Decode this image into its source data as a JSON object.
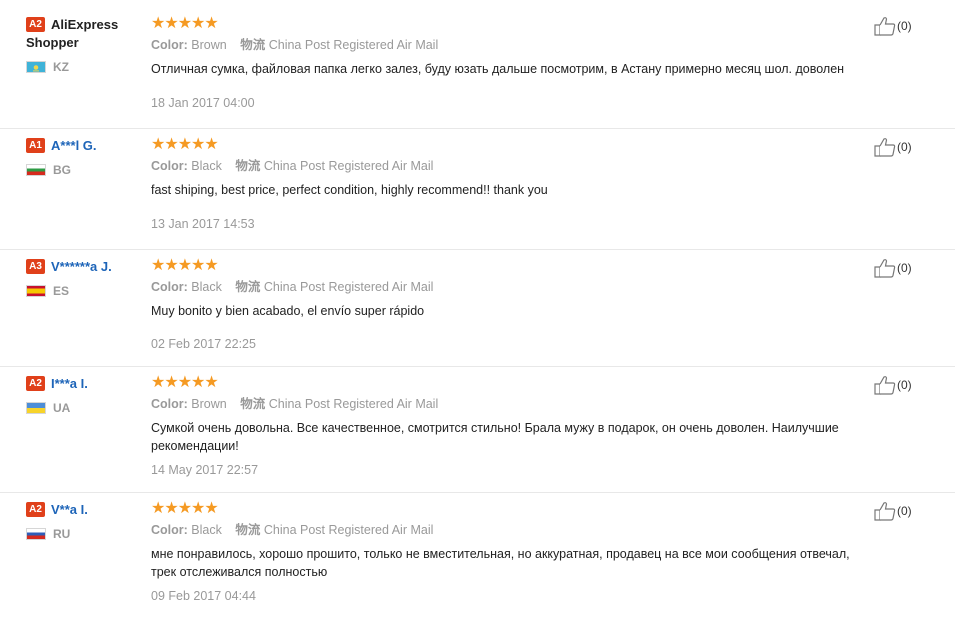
{
  "reviews": [
    {
      "level": "A2",
      "user": "AliExpress Shopper",
      "country": "KZ",
      "stars": "★★★★★",
      "color_label": "Color:",
      "color_value": "Brown",
      "shipping_label": "物流",
      "shipping_value": "China Post Registered Air Mail",
      "text": "Отличная сумка, файловая папка легко залез, буду юзать дальше посмотрим, в Астану примерно месяц шол. доволен",
      "date": "18 Jan 2017 04:00",
      "helpful": "(0)"
    },
    {
      "level": "A1",
      "user": "A***l G.",
      "country": "BG",
      "stars": "★★★★★",
      "color_label": "Color:",
      "color_value": "Black",
      "shipping_label": "物流",
      "shipping_value": "China Post Registered Air Mail",
      "text": "fast shiping, best price, perfect condition, highly recommend!! thank you",
      "date": "13 Jan 2017 14:53",
      "helpful": "(0)"
    },
    {
      "level": "A3",
      "user": "V******a J.",
      "country": "ES",
      "stars": "★★★★★",
      "color_label": "Color:",
      "color_value": "Black",
      "shipping_label": "物流",
      "shipping_value": "China Post Registered Air Mail",
      "text": "Muy bonito y bien acabado, el envío super rápido",
      "date": "02 Feb 2017 22:25",
      "helpful": "(0)"
    },
    {
      "level": "A2",
      "user": "I***a I.",
      "country": "UA",
      "stars": "★★★★★",
      "color_label": "Color:",
      "color_value": "Brown",
      "shipping_label": "物流",
      "shipping_value": "China Post Registered Air Mail",
      "text": "Сумкой очень довольна. Все качественное, смотрится стильно! Брала мужу в подарок, он очень доволен. Наилучшие рекомендации!",
      "date": "14 May 2017 22:57",
      "helpful": "(0)"
    },
    {
      "level": "A2",
      "user": "V**a I.",
      "country": "RU",
      "stars": "★★★★★",
      "color_label": "Color:",
      "color_value": "Black",
      "shipping_label": "物流",
      "shipping_value": "China Post Registered Air Mail",
      "text": "мне понравилось, хорошо прошито, только не вместительная, но аккуратная, продавец на все мои сообщения отвечал, трек отслеживался полностью",
      "date": "09 Feb 2017 04:44",
      "helpful": "(0)"
    }
  ],
  "colors": {
    "star": "#f59a23",
    "badge": "#e0401a",
    "username": "#1d64b8",
    "muted": "#999999"
  },
  "icons": {
    "thumb": "thumbs-up-icon",
    "flag": "country-flag-icon"
  }
}
